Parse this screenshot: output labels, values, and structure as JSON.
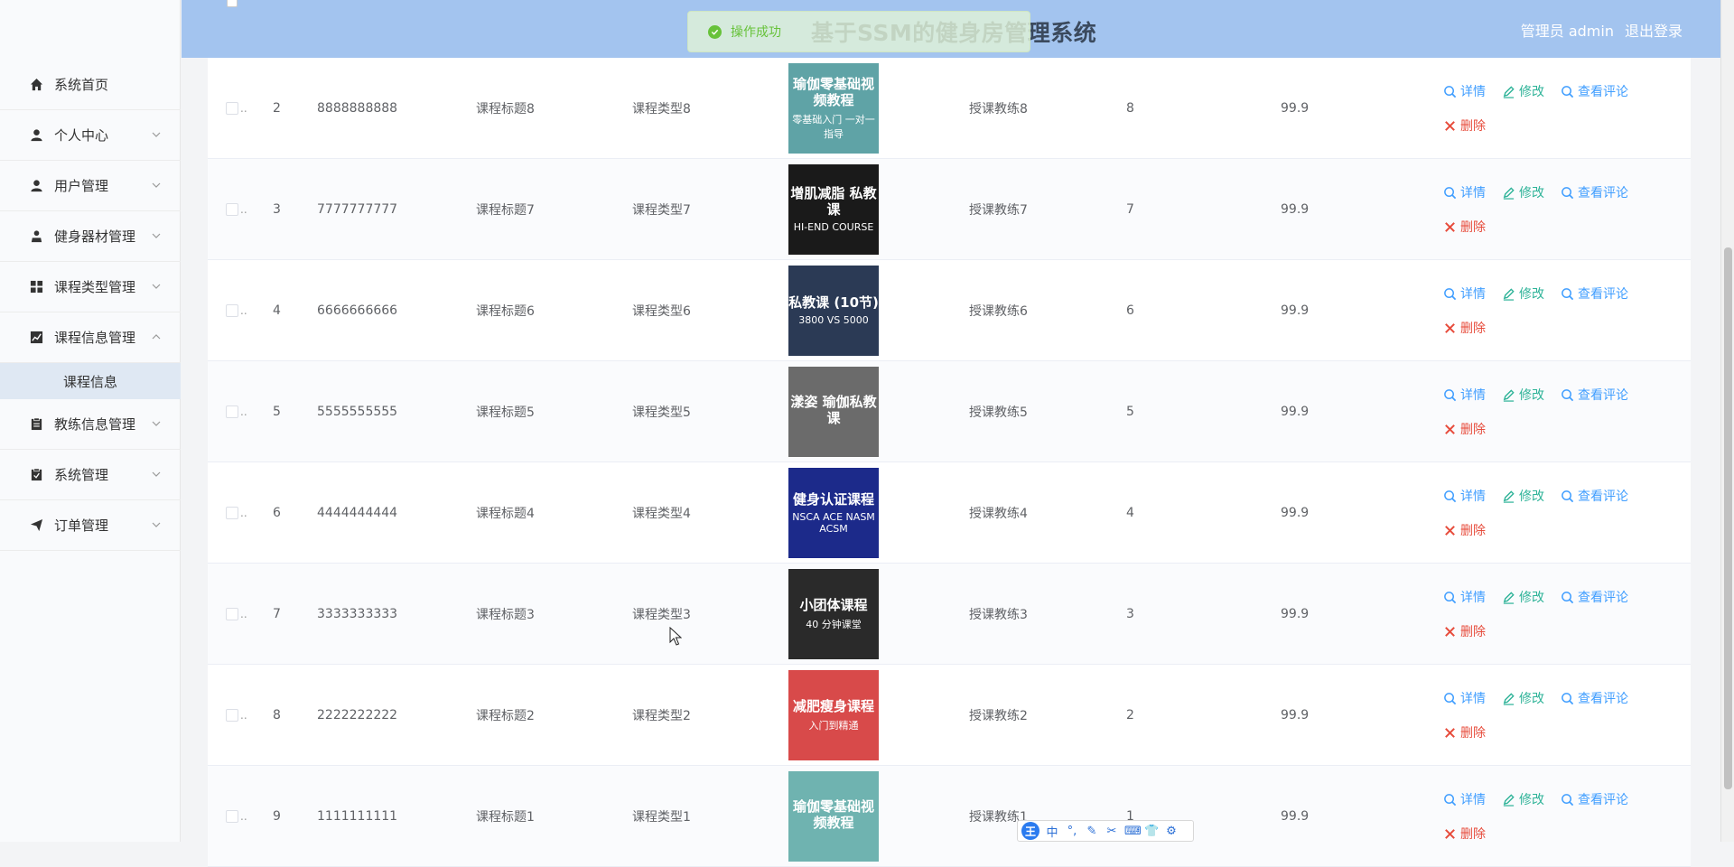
{
  "header": {
    "title": "基于SSM的健身房管理系统",
    "user_label": "管理员 admin",
    "logout": "退出登录"
  },
  "toast": {
    "text": "操作成功"
  },
  "sidebar": {
    "items": [
      {
        "label": "系统首页",
        "icon": "home-icon"
      },
      {
        "label": "个人中心",
        "icon": "user-icon"
      },
      {
        "label": "用户管理",
        "icon": "user-icon"
      },
      {
        "label": "健身器材管理",
        "icon": "user-icon"
      },
      {
        "label": "课程类型管理",
        "icon": "grid-icon"
      },
      {
        "label": "课程信息管理",
        "icon": "chart-icon",
        "expanded": true
      },
      {
        "label": "教练信息管理",
        "icon": "clipboard-icon"
      },
      {
        "label": "系统管理",
        "icon": "clipboard-icon"
      },
      {
        "label": "订单管理",
        "icon": "send-icon"
      }
    ],
    "subitem": "课程信息"
  },
  "actions": {
    "detail": "详情",
    "edit": "修改",
    "comments": "查看评论",
    "delete": "删除"
  },
  "rows": [
    {
      "index": "2",
      "code": "8888888888",
      "title": "课程标题8",
      "type": "课程类型8",
      "coach": "授课教练8",
      "num": "8",
      "price": "99.9",
      "img_text": "瑜伽零基础视频教程",
      "img_sub": "零基础入门 一对一指导"
    },
    {
      "index": "3",
      "code": "7777777777",
      "title": "课程标题7",
      "type": "课程类型7",
      "coach": "授课教练7",
      "num": "7",
      "price": "99.9",
      "img_text": "增肌减脂 私教课",
      "img_sub": "HI-END COURSE"
    },
    {
      "index": "4",
      "code": "6666666666",
      "title": "课程标题6",
      "type": "课程类型6",
      "coach": "授课教练6",
      "num": "6",
      "price": "99.9",
      "img_text": "私教课 (10节)",
      "img_sub": "3800 VS 5000"
    },
    {
      "index": "5",
      "code": "5555555555",
      "title": "课程标题5",
      "type": "课程类型5",
      "coach": "授课教练5",
      "num": "5",
      "price": "99.9",
      "img_text": "漾姿 瑜伽私教课",
      "img_sub": ""
    },
    {
      "index": "6",
      "code": "4444444444",
      "title": "课程标题4",
      "type": "课程类型4",
      "coach": "授课教练4",
      "num": "4",
      "price": "99.9",
      "img_text": "健身认证课程",
      "img_sub": "NSCA ACE NASM ACSM"
    },
    {
      "index": "7",
      "code": "3333333333",
      "title": "课程标题3",
      "type": "课程类型3",
      "coach": "授课教练3",
      "num": "3",
      "price": "99.9",
      "img_text": "小团体课程",
      "img_sub": "40 分钟课堂"
    },
    {
      "index": "8",
      "code": "2222222222",
      "title": "课程标题2",
      "type": "课程类型2",
      "coach": "授课教练2",
      "num": "2",
      "price": "99.9",
      "img_text": "减肥瘦身课程",
      "img_sub": "入门到精通"
    },
    {
      "index": "9",
      "code": "1111111111",
      "title": "课程标题1",
      "type": "课程类型1",
      "coach": "授课教练1",
      "num": "1",
      "price": "99.9",
      "img_text": "瑜伽零基础视频教程",
      "img_sub": ""
    }
  ],
  "thumb_colors": [
    "#5fa3a6",
    "#1a1a1a",
    "#2b3a55",
    "#6b6b6b",
    "#1c2a8a",
    "#2a2a2a",
    "#d84a4a",
    "#6fb3b0"
  ],
  "ime": {
    "logo": "王",
    "mode": "中"
  },
  "colors": {
    "header": "#a3c4ef",
    "detail": "#409eff",
    "edit": "#2eb398",
    "delete": "#e74c3c"
  }
}
